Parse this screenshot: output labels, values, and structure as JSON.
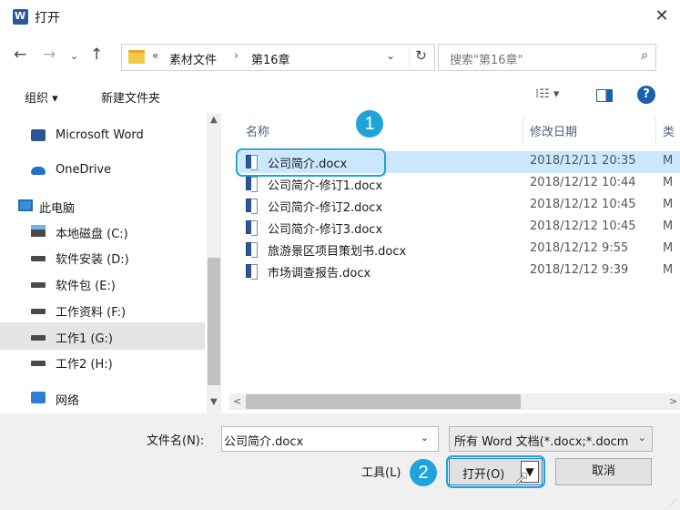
{
  "window": {
    "title": "打开",
    "close": "✕"
  },
  "address": {
    "prefix": "«",
    "crumbs": [
      "素材文件",
      "第16章"
    ],
    "separator": "›",
    "search_placeholder": "搜索\"第16章\""
  },
  "toolbar": {
    "organize": "组织 ▾",
    "new_folder": "新建文件夹",
    "view": "⁞☷ ▾"
  },
  "nav": {
    "items": [
      {
        "label": "Microsoft Word",
        "icon": "word-icon"
      },
      {
        "label": "OneDrive",
        "icon": "cloud-icon"
      },
      {
        "label": "此电脑",
        "icon": "pc-icon"
      },
      {
        "label": "本地磁盘 (C:)",
        "icon": "drive-icon"
      },
      {
        "label": "软件安装 (D:)",
        "icon": "drive-icon"
      },
      {
        "label": "软件包 (E:)",
        "icon": "drive-icon"
      },
      {
        "label": "工作资料 (F:)",
        "icon": "drive-icon"
      },
      {
        "label": "工作1 (G:)",
        "icon": "drive-icon",
        "selected": true
      },
      {
        "label": "工作2 (H:)",
        "icon": "drive-icon"
      },
      {
        "label": "网络",
        "icon": "network-icon"
      }
    ]
  },
  "list": {
    "columns": {
      "name": "名称",
      "date": "修改日期",
      "type": "类"
    },
    "files": [
      {
        "name": "公司简介.docx",
        "date": "2018/12/11  20:35",
        "type": "M",
        "selected": true
      },
      {
        "name": "公司简介-修订1.docx",
        "date": "2018/12/12  10:44",
        "type": "M"
      },
      {
        "name": "公司简介-修订2.docx",
        "date": "2018/12/12  10:45",
        "type": "M"
      },
      {
        "name": "公司简介-修订3.docx",
        "date": "2018/12/12  10:45",
        "type": "M"
      },
      {
        "name": "旅游景区项目策划书.docx",
        "date": "2018/12/12  9:55",
        "type": "M"
      },
      {
        "name": "市场调查报告.docx",
        "date": "2018/12/12  9:39",
        "type": "M"
      }
    ]
  },
  "bottom": {
    "filename_label": "文件名(N):",
    "filename_value": "公司简介.docx",
    "filetype_value": "所有 Word 文档(*.docx;*.docm",
    "tools": "工具(L)",
    "open": "打开(O)",
    "cancel": "取消"
  },
  "annotations": {
    "step1": "1",
    "step2": "2"
  },
  "colors": {
    "accent": "#1fa3da",
    "selection": "#cce8ff"
  }
}
